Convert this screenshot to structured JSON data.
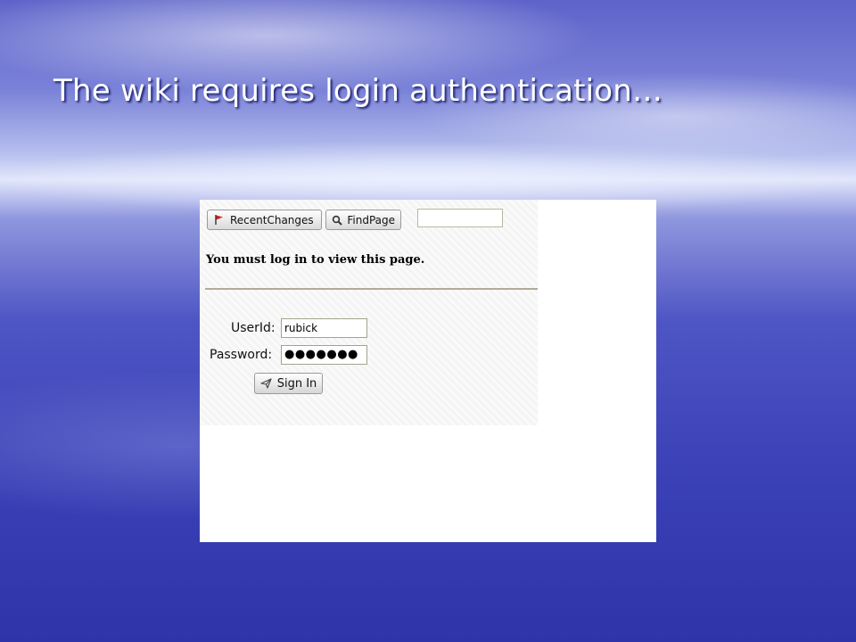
{
  "slide": {
    "title": "The wiki requires login authentication…"
  },
  "wiki": {
    "nav": {
      "recent_changes_label": "RecentChanges",
      "recent_changes_icon": "flag-icon",
      "find_page_label": "FindPage",
      "find_page_icon": "magnifier-icon",
      "search_value": ""
    },
    "notice": "You must log in to view this page.",
    "login": {
      "userid_label": "UserId:",
      "userid_value": "rubick",
      "password_label": "Password:",
      "password_value": "●●●●●●●",
      "sign_in_label": "Sign In",
      "sign_in_icon": "paper-plane-icon"
    }
  }
}
